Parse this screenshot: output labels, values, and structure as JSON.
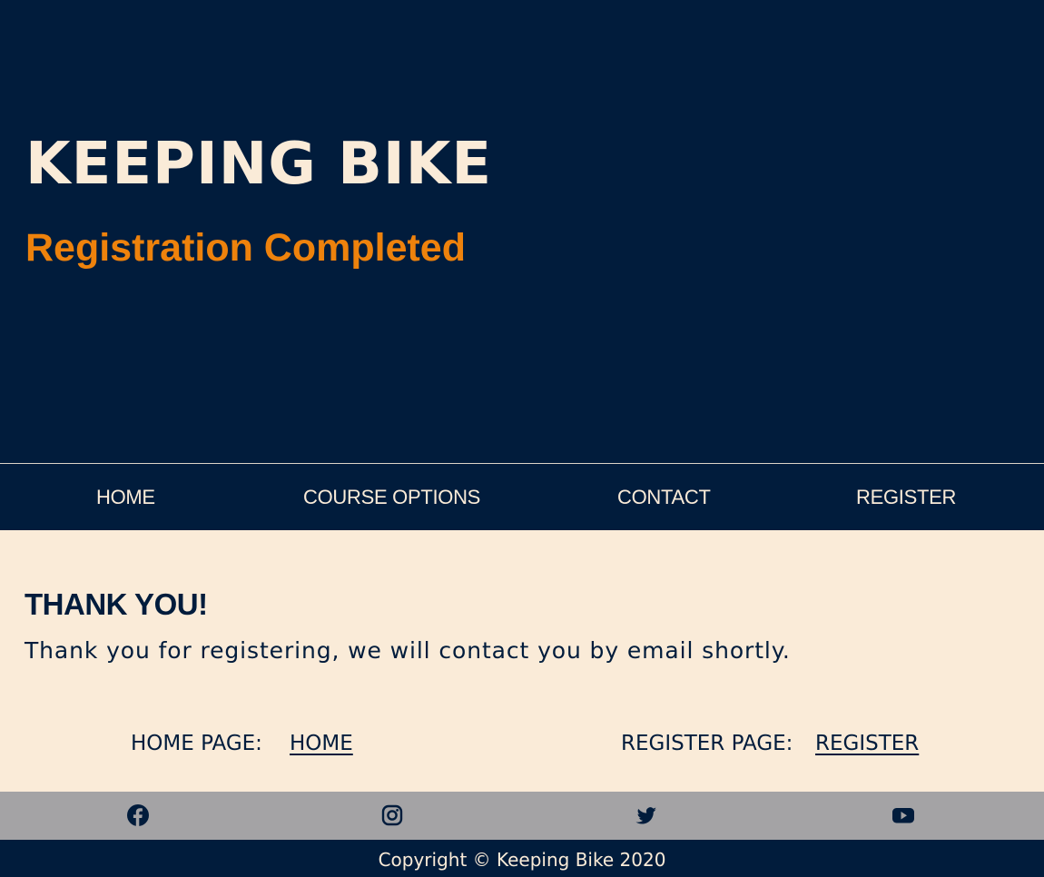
{
  "header": {
    "title": "KEEPING BIKE",
    "subtitle": "Registration Completed"
  },
  "nav": {
    "items": [
      {
        "label": "HOME"
      },
      {
        "label": "COURSE OPTIONS"
      },
      {
        "label": "CONTACT"
      },
      {
        "label": "REGISTER"
      }
    ]
  },
  "main": {
    "heading": "THANK YOU!",
    "message": "Thank you for registering, we will contact you by email shortly.",
    "home_label": "HOME PAGE:",
    "home_link": "HOME",
    "register_label": "REGISTER PAGE:",
    "register_link": "REGISTER"
  },
  "social": {
    "icons": [
      "facebook-icon",
      "instagram-icon",
      "twitter-icon",
      "youtube-icon"
    ]
  },
  "footer": {
    "copyright": "Copyright © Keeping Bike 2020"
  },
  "colors": {
    "navy": "#011c3c",
    "cream": "#faebd8",
    "orange": "#ee820c",
    "gray": "#a4a3a5"
  }
}
